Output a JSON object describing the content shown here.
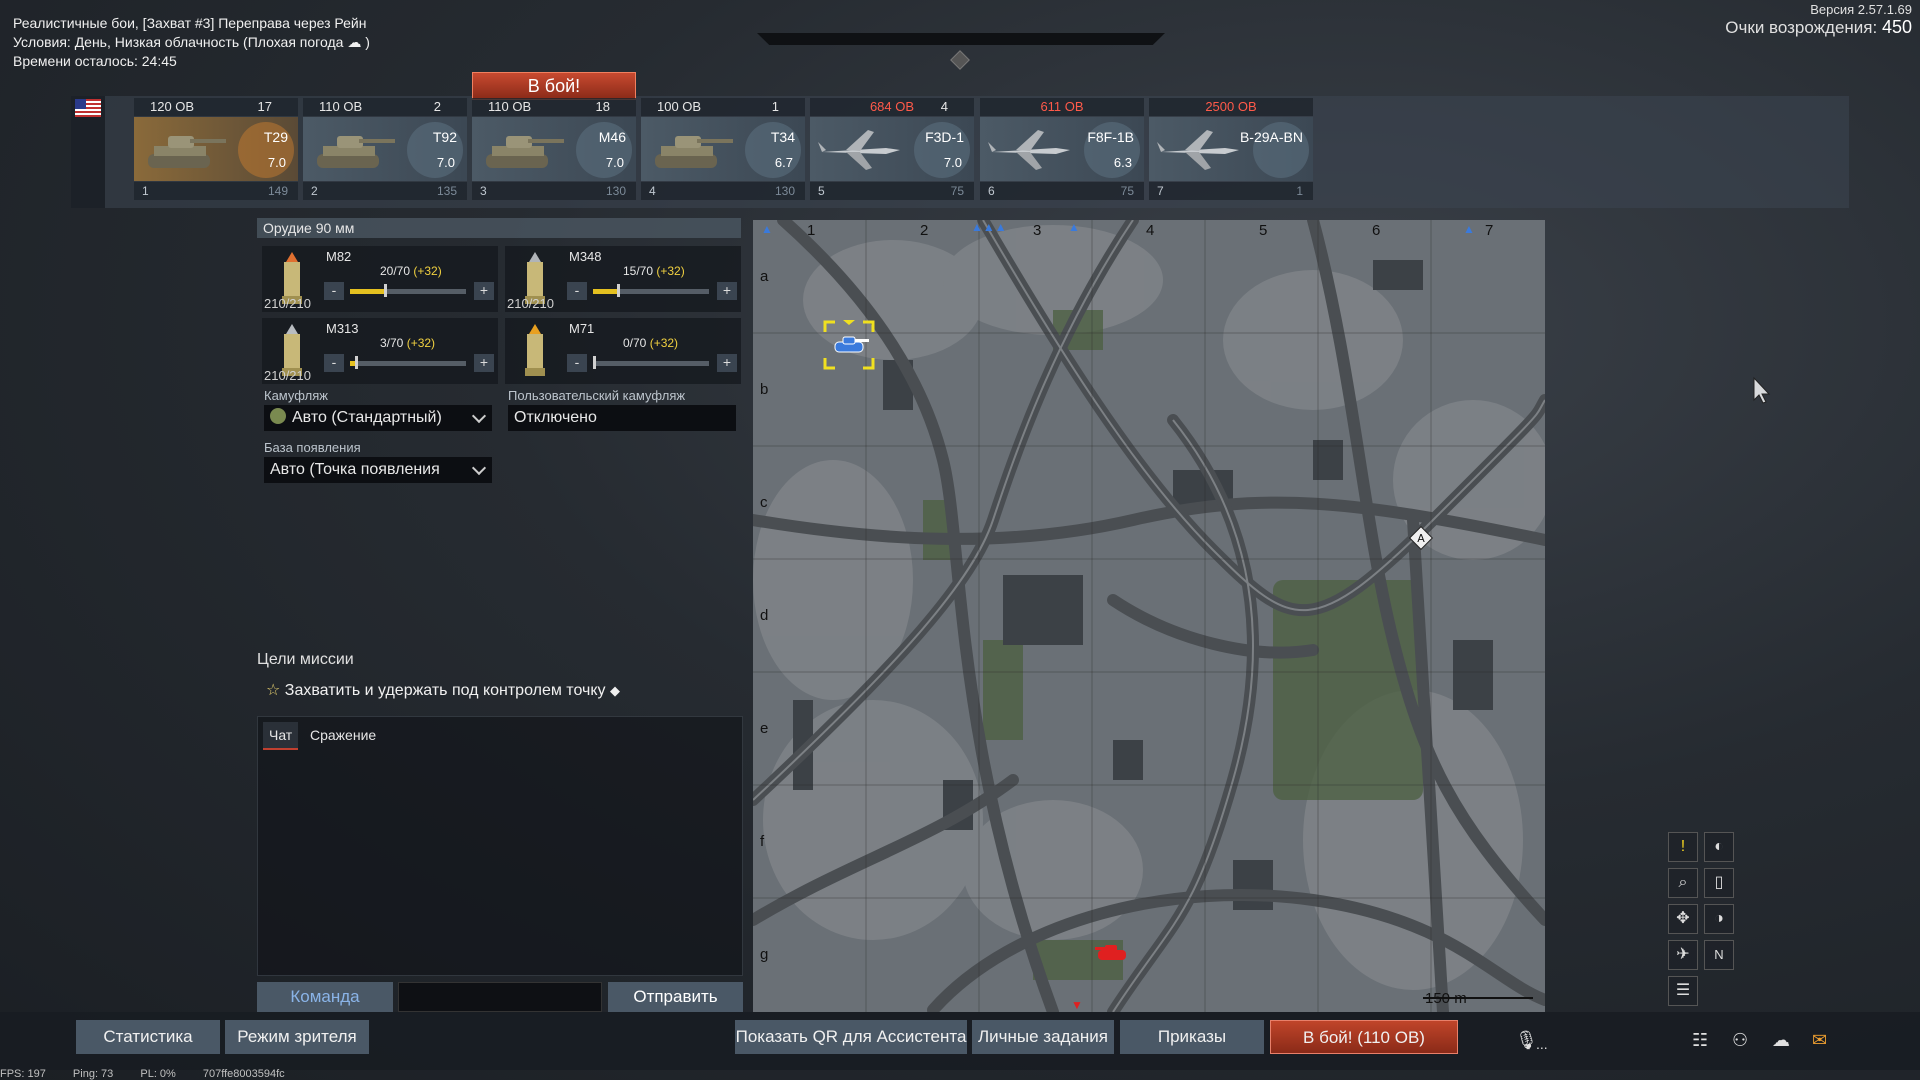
{
  "header": {
    "title": "Реалистичные бои, [Захват #3] Переправа через Рейн",
    "conditions": "Условия: День, Низкая облачность  (Плохая погода",
    "conditions_end": ")",
    "time_left": "Времени осталось: 24:45",
    "version": "Версия 2.57.1.69",
    "respawn_label": "Очки возрождения:",
    "respawn_value": "450"
  },
  "to_battle_top": "В бой!",
  "vehicles": [
    {
      "cost": "120 ОВ",
      "count": "17",
      "name": "T29",
      "br": "7.0",
      "slot": "1",
      "crew": "149"
    },
    {
      "cost": "110 ОВ",
      "count": "2",
      "name": "T92",
      "br": "7.0",
      "slot": "2",
      "crew": "135"
    },
    {
      "cost": "110 ОВ",
      "count": "18",
      "name": "M46",
      "br": "7.0",
      "slot": "3",
      "crew": "130"
    },
    {
      "cost": "100 ОВ",
      "count": "1",
      "name": "T34",
      "br": "6.7",
      "slot": "4",
      "crew": "130"
    },
    {
      "cost": "684 ОВ",
      "count": "4",
      "name": "F3D-1",
      "br": "7.0",
      "slot": "5",
      "crew": "75"
    },
    {
      "cost": "611 ОВ",
      "count": "",
      "name": "F8F-1B",
      "br": "6.3",
      "slot": "6",
      "crew": "75"
    },
    {
      "cost": "2500 ОВ",
      "count": "",
      "name": "B-29A-BN",
      "br": "",
      "slot": "7",
      "crew": "1"
    }
  ],
  "weapons": {
    "gun_title": "Орудие 90 мм",
    "shells": [
      {
        "name": "M82",
        "count": "20/70",
        "bonus": "(+32)",
        "stock": "210/210",
        "fraction": 0.29
      },
      {
        "name": "M348",
        "count": "15/70",
        "bonus": "(+32)",
        "stock": "210/210",
        "fraction": 0.21
      },
      {
        "name": "M313",
        "count": "3/70",
        "bonus": "(+32)",
        "stock": "210/210",
        "fraction": 0.04
      },
      {
        "name": "M71",
        "count": "0/70",
        "bonus": "(+32)",
        "stock": "",
        "fraction": 0.0
      }
    ],
    "minus": "-",
    "plus": "+"
  },
  "camo": {
    "label": "Камуфляж",
    "value": "Авто (Стандартный)"
  },
  "user_camo": {
    "label": "Пользовательский камуфляж",
    "value": "Отключено"
  },
  "spawn_base": {
    "label": "База появления",
    "value": "Авто (Точка появления"
  },
  "mission": {
    "title": "Цели миссии",
    "objective": "Захватить и удержать под контролем точку"
  },
  "chat": {
    "tab_chat": "Чат",
    "tab_battle": "Сражение",
    "team": "Команда",
    "send": "Отправить"
  },
  "map": {
    "cols": [
      "1",
      "2",
      "3",
      "4",
      "5",
      "6",
      "7"
    ],
    "rows": [
      "a",
      "b",
      "c",
      "d",
      "e",
      "f",
      "g"
    ],
    "scale": "150 m",
    "capture_point": "A"
  },
  "tools": {
    "n_label": "N"
  },
  "bottom": {
    "stats": "Статистика",
    "spectator": "Режим зрителя",
    "qr": "Показать QR для Ассистента",
    "tasks": "Личные задания",
    "orders": "Приказы",
    "battle": "В бой! (110 ОВ)",
    "mic": "..."
  },
  "status": {
    "fps": "FPS: 197",
    "ping": "Ping: 73",
    "pl": "PL: 0%",
    "hash": "707ffe8003594fc"
  },
  "colors": {
    "accent_red": "#c0452a",
    "yellow": "#e4c020",
    "ally": "#3a7adc",
    "enemy": "#e02020"
  }
}
